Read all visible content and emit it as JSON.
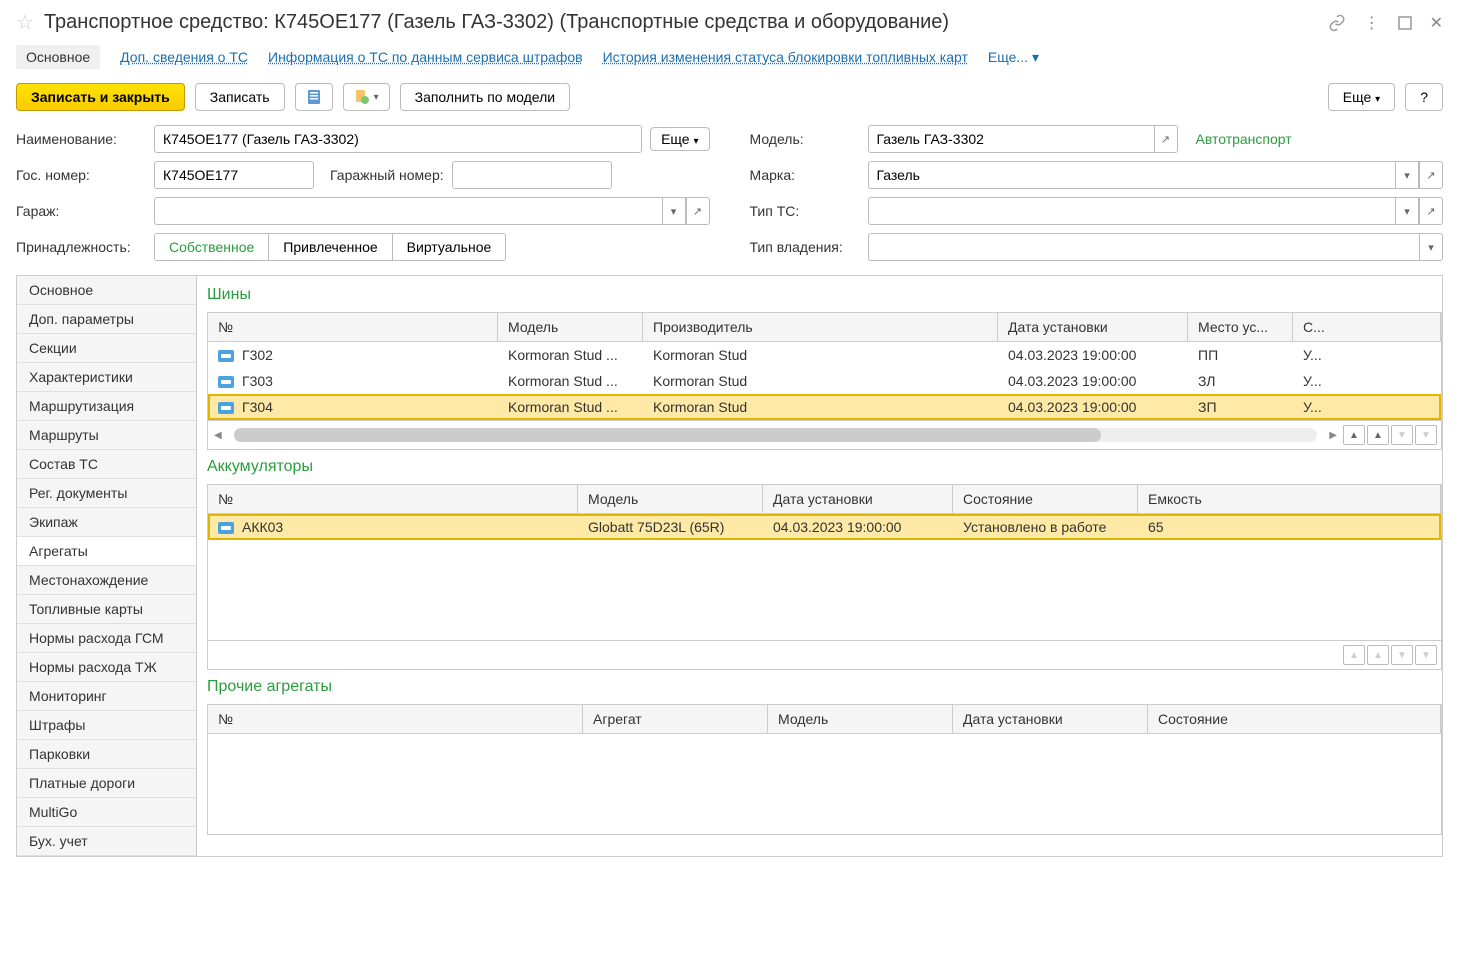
{
  "title": "Транспортное средство: К745ОЕ177 (Газель ГАЗ-3302) (Транспортные средства и оборудование)",
  "tabs": {
    "main": "Основное",
    "additional": "Доп. сведения о ТС",
    "fines_info": "Информация о ТС по данным сервиса штрафов",
    "block_history": "История изменения статуса блокировки топливных карт",
    "more": "Еще..."
  },
  "toolbar": {
    "save_close": "Записать и закрыть",
    "save": "Записать",
    "fill_by_model": "Заполнить по модели",
    "more": "Еще",
    "help": "?"
  },
  "form": {
    "name_label": "Наименование:",
    "name_value": "К745ОЕ177 (Газель ГАЗ-3302)",
    "name_more": "Еще",
    "gosnum_label": "Гос. номер:",
    "gosnum_value": "К745ОЕ177",
    "garage_num_label": "Гаражный номер:",
    "garage_num_value": "",
    "garage_label": "Гараж:",
    "garage_value": "",
    "ownership_label": "Принадлежность:",
    "ownership_own": "Собственное",
    "ownership_hired": "Привлеченное",
    "ownership_virtual": "Виртуальное",
    "model_label": "Модель:",
    "model_value": "Газель ГАЗ-3302",
    "model_category": "Автотранспорт",
    "brand_label": "Марка:",
    "brand_value": "Газель",
    "type_label": "Тип ТС:",
    "type_value": "",
    "own_type_label": "Тип владения:",
    "own_type_value": ""
  },
  "sidebar": {
    "items": [
      "Основное",
      "Доп. параметры",
      "Секции",
      "Характеристики",
      "Маршрутизация",
      "Маршруты",
      "Состав ТС",
      "Рег. документы",
      "Экипаж",
      "Агрегаты",
      "Местонахождение",
      "Топливные карты",
      "Нормы расхода ГСМ",
      "Нормы расхода ТЖ",
      "Мониторинг",
      "Штрафы",
      "Парковки",
      "Платные дороги",
      "MultiGo",
      "Бух. учет"
    ],
    "active_index": 9
  },
  "tires": {
    "title": "Шины",
    "columns": {
      "num": "№",
      "model": "Модель",
      "mfr": "Производитель",
      "install_date": "Дата установки",
      "place": "Место ус...",
      "state": "С..."
    },
    "rows": [
      {
        "num": "Г302",
        "model": "Kormoran Stud ...",
        "mfr": "Kormoran Stud",
        "install_date": "04.03.2023 19:00:00",
        "place": "ПП",
        "state": "У..."
      },
      {
        "num": "Г303",
        "model": "Kormoran Stud ...",
        "mfr": "Kormoran Stud",
        "install_date": "04.03.2023 19:00:00",
        "place": "ЗЛ",
        "state": "У..."
      },
      {
        "num": "Г304",
        "model": "Kormoran Stud ...",
        "mfr": "Kormoran Stud",
        "install_date": "04.03.2023 19:00:00",
        "place": "ЗП",
        "state": "У..."
      }
    ],
    "selected_index": 2
  },
  "batteries": {
    "title": "Аккумуляторы",
    "columns": {
      "num": "№",
      "model": "Модель",
      "install_date": "Дата установки",
      "state": "Состояние",
      "capacity": "Емкость"
    },
    "rows": [
      {
        "num": "АКК03",
        "model": "Globatt 75D23L (65R)",
        "install_date": "04.03.2023 19:00:00",
        "state": "Установлено в работе",
        "capacity": "65"
      }
    ],
    "selected_index": 0
  },
  "other_units": {
    "title": "Прочие агрегаты",
    "columns": {
      "num": "№",
      "unit": "Агрегат",
      "model": "Модель",
      "install_date": "Дата установки",
      "state": "Состояние"
    }
  }
}
